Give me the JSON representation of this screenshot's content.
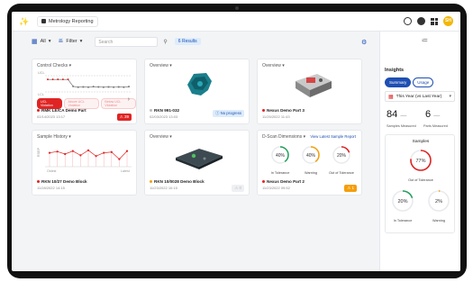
{
  "app": {
    "title": "Metrology Reporting",
    "avatar_initials": "SH"
  },
  "toolbar": {
    "all_label": "All",
    "filter_label": "Filter",
    "search_placeholder": "Search",
    "results_label": "6 Results"
  },
  "cards": {
    "control_checks": {
      "title": "Control Checks",
      "y_labels": [
        "UCL",
        "LCL"
      ],
      "chips": [
        "UCL Violation",
        "Above UCL Violation",
        "Below UCL Violation"
      ],
      "name": "RMK LE/CA Demo Part",
      "date": "02/14/2023 13:17",
      "badge": "39",
      "series": [
        0.62,
        0.62,
        0.62,
        0.62,
        0.62,
        0.38,
        0.35,
        0.36,
        0.35,
        0.37,
        0.36,
        0.35,
        0.36,
        0.35,
        0.36,
        0.35,
        0.37
      ]
    },
    "overview_1": {
      "title": "Overview",
      "name": "RKN 991-032",
      "date": "02/03/2023 13:03",
      "badge": "No progress"
    },
    "overview_2": {
      "title": "Overview",
      "name": "Nexus Demo Part 3",
      "date": "11/25/2022 11:43"
    },
    "sample_history": {
      "title": "Sample History",
      "y_label": "RSEP",
      "x_labels": [
        "Oldest",
        "Latest"
      ],
      "name": "RKN 10/27 Demo Block",
      "date": "11/28/2022 14:15",
      "series": [
        0.55,
        0.6,
        0.5,
        0.62,
        0.45,
        0.65,
        0.42,
        0.55,
        0.58,
        0.3,
        0.62
      ]
    },
    "overview_3": {
      "title": "Overview",
      "name": "RKN 10/0028 Demo Block",
      "date": "11/23/2022 10:15",
      "badge": "0"
    },
    "status_dims": {
      "title": "D-Scan Dimensions",
      "link": "View Latest Sample Report",
      "rings": [
        {
          "value": "40%",
          "label": "In Tolerance",
          "color": "#22a05b",
          "pct": 0.4
        },
        {
          "value": "40%",
          "label": "Warning",
          "color": "#f59e0b",
          "pct": 0.4
        },
        {
          "value": "20%",
          "label": "Out of Tolerance",
          "color": "#e02424",
          "pct": 0.2
        }
      ],
      "name": "Nexus Demo Part 2",
      "date": "11/23/2022 09:52",
      "badge": "1"
    }
  },
  "insights": {
    "title": "Insights",
    "tabs": [
      "Summary",
      "Usage"
    ],
    "range_label": "This Year (vs Last Year)",
    "samples_measured": {
      "value": "84",
      "label": "Samples Measured"
    },
    "parts_measured": {
      "value": "6",
      "label": "Parts Measured"
    },
    "samples_title": "Samples",
    "rings": [
      {
        "value": "77%",
        "label": "Out of Tolerance",
        "color": "#e02424",
        "pct": 0.77
      },
      {
        "value": "20%",
        "label": "In Tolerance",
        "color": "#22a05b",
        "pct": 0.2
      },
      {
        "value": "2%",
        "label": "Warning",
        "color": "#f59e0b",
        "pct": 0.02
      }
    ]
  }
}
